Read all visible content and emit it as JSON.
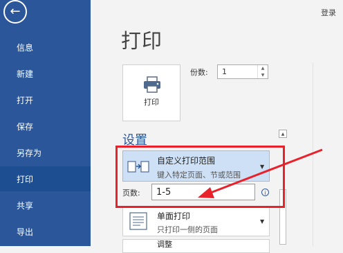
{
  "sidebar": {
    "items": [
      {
        "label": "信息"
      },
      {
        "label": "新建"
      },
      {
        "label": "打开"
      },
      {
        "label": "保存"
      },
      {
        "label": "另存为"
      },
      {
        "label": "打印"
      },
      {
        "label": "共享"
      },
      {
        "label": "导出"
      }
    ],
    "active_index": 5
  },
  "header": {
    "signin": "登录",
    "title": "打印"
  },
  "print": {
    "button_label": "打印",
    "copies_label": "份数:",
    "copies_value": "1"
  },
  "settings": {
    "section_title": "设置",
    "range": {
      "title": "自定义打印范围",
      "subtitle": "键入特定页面、节或范围"
    },
    "pages_label": "页数:",
    "pages_value": "1-5",
    "sided": {
      "title": "单面打印",
      "subtitle": "只打印一侧的页面"
    },
    "collate": {
      "title": "调整"
    }
  },
  "colors": {
    "sidebar": "#2b579a",
    "active": "#1e4e92",
    "accent": "#2b579a",
    "annotation": "#e8212b",
    "dropdown_selected": "#cde0f5"
  },
  "icons": {
    "back": "back-arrow-icon",
    "printer": "printer-icon",
    "pages": "custom-range-icon",
    "info": "info-icon",
    "onesided": "one-sided-icon"
  }
}
